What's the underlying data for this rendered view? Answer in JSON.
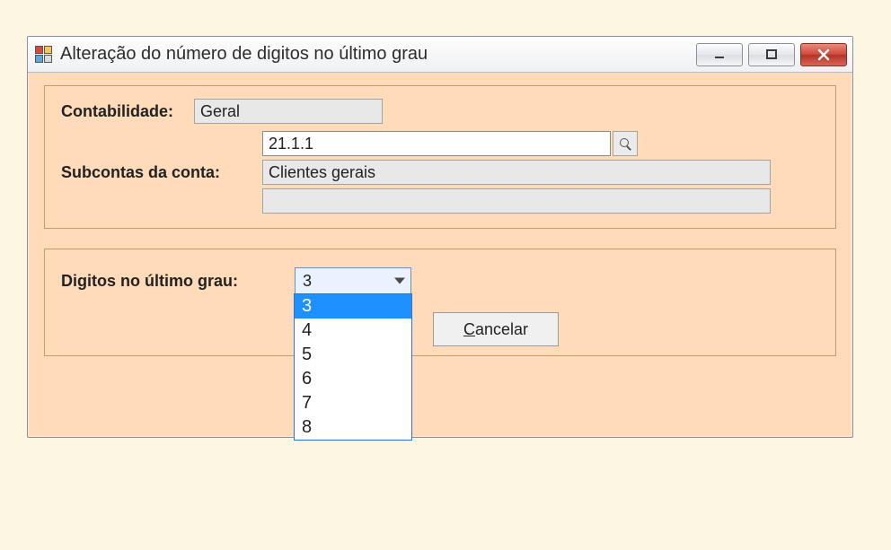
{
  "window": {
    "title": "Alteração do número de digitos no último grau"
  },
  "labels": {
    "contabilidade": "Contabilidade:",
    "subcontas": "Subcontas da conta:",
    "digitos": "Digitos no último grau:"
  },
  "fields": {
    "contabilidade_value": "Geral",
    "subconta_value": "21.1.1",
    "descricao1": "Clientes gerais",
    "descricao2": ""
  },
  "digitos": {
    "selected": "3",
    "options": [
      "3",
      "4",
      "5",
      "6",
      "7",
      "8"
    ]
  },
  "buttons": {
    "confirmar_visible_fragment": "C",
    "cancelar_accel": "C",
    "cancelar_rest": "ancelar"
  },
  "icons": {
    "app": "form-icon",
    "minimize": "minimize-icon",
    "maximize": "maximize-icon",
    "close": "close-icon",
    "lookup": "search-icon",
    "chevron": "chevron-down-icon"
  }
}
